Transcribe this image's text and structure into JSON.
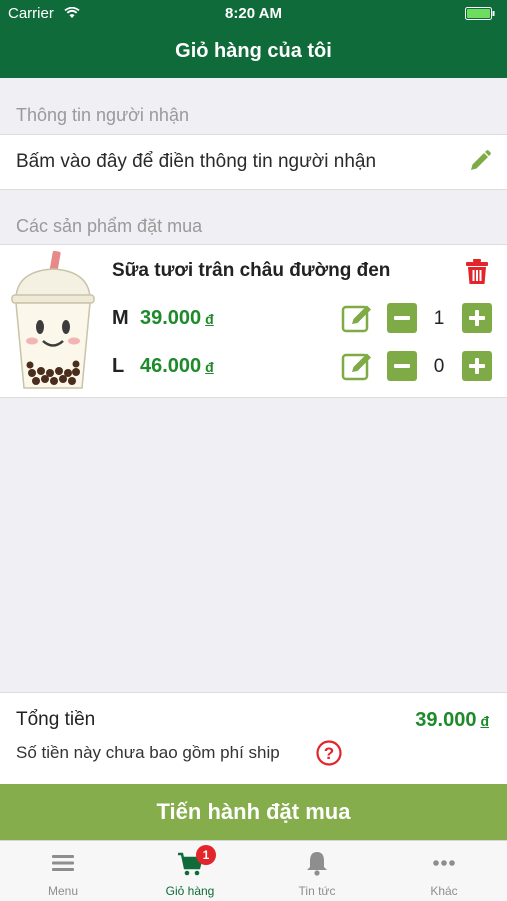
{
  "status_bar": {
    "carrier": "Carrier",
    "time": "8:20 AM"
  },
  "nav": {
    "title": "Giỏ hàng của tôi"
  },
  "recipient_section": {
    "header": "Thông tin người nhận",
    "prompt": "Bấm vào đây để điền thông tin người nhận"
  },
  "products_section": {
    "header": "Các sản phẩm đặt mua"
  },
  "product": {
    "name": "Sữa tươi trân châu đường đen",
    "sizes": [
      {
        "label": "M",
        "price": "39.000",
        "currency": "đ",
        "quantity": "1"
      },
      {
        "label": "L",
        "price": "46.000",
        "currency": "đ",
        "quantity": "0"
      }
    ]
  },
  "summary": {
    "total_label": "Tổng tiền",
    "total_value": "39.000",
    "currency": "đ",
    "ship_note": "Số tiền này chưa bao gồm phí ship"
  },
  "checkout": {
    "label": "Tiến hành đặt mua"
  },
  "tabs": [
    {
      "label": "Menu",
      "icon": "menu-icon"
    },
    {
      "label": "Giỏ hàng",
      "icon": "cart-icon",
      "badge": "1"
    },
    {
      "label": "Tin tức",
      "icon": "bell-icon"
    },
    {
      "label": "Khác",
      "icon": "more-icon"
    }
  ],
  "colors": {
    "brand": "#0f6b3a",
    "accent": "#85ad4b",
    "price": "#1e8b2b",
    "danger": "#e3242b"
  }
}
